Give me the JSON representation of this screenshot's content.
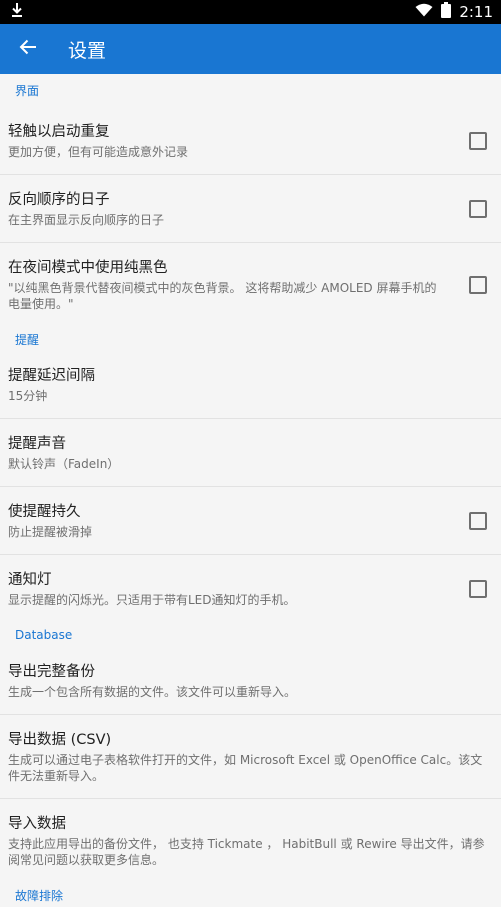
{
  "status_bar": {
    "time": "2:11",
    "left_icon": "download-icon",
    "right_icons": [
      "wifi-icon",
      "battery-icon"
    ]
  },
  "app_bar": {
    "title": "设置",
    "back_icon": "arrow-left-icon",
    "color": "#1976d2"
  },
  "sections": [
    {
      "header": "界面",
      "items": [
        {
          "title": "轻触以启动重复",
          "summary": "更加方便，但有可能造成意外记录",
          "checkbox": true
        },
        {
          "title": "反向顺序的日子",
          "summary": "在主界面显示反向顺序的日子",
          "checkbox": true
        },
        {
          "title": "在夜间模式中使用纯黑色",
          "summary": "\"以纯黑色背景代替夜间模式中的灰色背景。 这将帮助减少 AMOLED 屏幕手机的电量使用。\"",
          "checkbox": true
        }
      ]
    },
    {
      "header": "提醒",
      "items": [
        {
          "title": "提醒延迟间隔",
          "summary": "15分钟",
          "checkbox": false
        },
        {
          "title": "提醒声音",
          "summary": "默认铃声（FadeIn）",
          "checkbox": false
        },
        {
          "title": "使提醒持久",
          "summary": "防止提醒被滑掉",
          "checkbox": true
        },
        {
          "title": "通知灯",
          "summary": "显示提醒的闪烁光。只适用于带有LED通知灯的手机。",
          "checkbox": true
        }
      ]
    },
    {
      "header": "Database",
      "items": [
        {
          "title": "导出完整备份",
          "summary": "生成一个包含所有数据的文件。该文件可以重新导入。",
          "checkbox": false
        },
        {
          "title": "导出数据 (CSV)",
          "summary": "生成可以通过电子表格软件打开的文件，如 Microsoft Excel 或 OpenOffice Calc。该文件无法重新导入。",
          "checkbox": false
        },
        {
          "title": "导入数据",
          "summary": "支持此应用导出的备份文件， 也支持 Tickmate ， HabitBull 或 Rewire 导出文件，请参阅常见问题以获取更多信息。",
          "checkbox": false
        }
      ]
    },
    {
      "header": "故障排除",
      "items": []
    }
  ]
}
